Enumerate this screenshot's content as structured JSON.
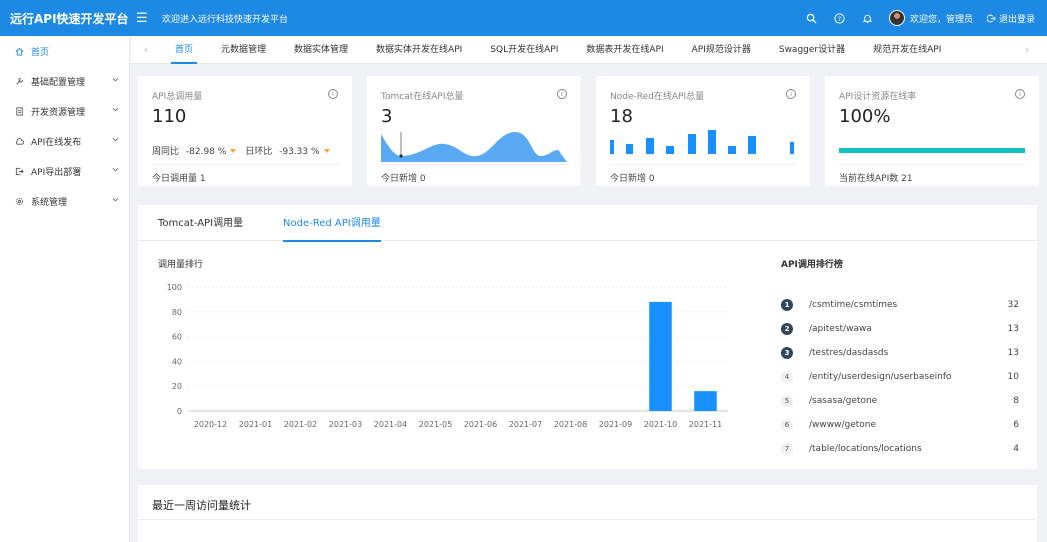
{
  "header": {
    "title": "远行API快速开发平台",
    "welcome": "欢迎进入远行科技快速开发平台",
    "user_greeting": "欢迎您，管理员",
    "logout_label": "退出登录",
    "icons": [
      "search-icon",
      "help-icon",
      "bell-icon"
    ]
  },
  "sidebar": {
    "items": [
      {
        "label": "首页",
        "icon": "home-icon",
        "active": true
      },
      {
        "label": "基础配置管理",
        "icon": "wrench-icon"
      },
      {
        "label": "开发资源管理",
        "icon": "document-icon"
      },
      {
        "label": "API在线发布",
        "icon": "cloud-icon"
      },
      {
        "label": "API导出部署",
        "icon": "export-icon"
      },
      {
        "label": "系统管理",
        "icon": "gear-icon"
      }
    ]
  },
  "tabs": {
    "items": [
      "首页",
      "元数据管理",
      "数据实体管理",
      "数据实体开发在线API",
      "SQL开发在线API",
      "数据表开发在线API",
      "API规范设计器",
      "Swagger设计器",
      "规范开发在线API"
    ],
    "active": 0
  },
  "cards": [
    {
      "title": "API总调用量",
      "value": "110",
      "compare_week_label": "周同比",
      "compare_week_value": "-82.98 %",
      "compare_day_label": "日环比",
      "compare_day_value": "-93.33 %",
      "footer": "今日调用量 1"
    },
    {
      "title": "Tomcat在线API总量",
      "value": "3",
      "footer": "今日新增 0"
    },
    {
      "title": "Node-Red在线API总量",
      "value": "18",
      "footer": "今日新增 0"
    },
    {
      "title": "API设计资源在线率",
      "value": "100%",
      "progress": 1.0,
      "footer": "当前在线API数 21"
    }
  ],
  "panel": {
    "tabs": [
      "Tomcat-API调用量",
      "Node-Red API调用量"
    ],
    "active_tab": 1,
    "chart_title": "调用量排行",
    "ranking_title": "API调用排行榜",
    "ranking": [
      {
        "rank": "1",
        "path": "/csmtime/csmtimes",
        "count": "32"
      },
      {
        "rank": "2",
        "path": "/apitest/wawa",
        "count": "13"
      },
      {
        "rank": "3",
        "path": "/testres/dasdasds",
        "count": "13"
      },
      {
        "rank": "4",
        "path": "/entity/userdesign/userbaseinfo",
        "count": "10"
      },
      {
        "rank": "5",
        "path": "/sasasa/getone",
        "count": "8"
      },
      {
        "rank": "6",
        "path": "/wwww/getone",
        "count": "6"
      },
      {
        "rank": "7",
        "path": "/table/locations/locations",
        "count": "4"
      }
    ]
  },
  "bottom": {
    "title": "最近一周访问量统计"
  },
  "colors": {
    "primary": "#1e88e5",
    "bar": "#1890ff",
    "progress": "#13c2c2",
    "area": "#5aa9f5"
  },
  "chart_data": {
    "type": "bar",
    "title": "调用量排行",
    "categories": [
      "2020-12",
      "2021-01",
      "2021-02",
      "2021-03",
      "2021-04",
      "2021-05",
      "2021-06",
      "2021-07",
      "2021-08",
      "2021-09",
      "2021-10",
      "2021-11"
    ],
    "values": [
      0,
      0,
      0,
      0,
      0,
      0,
      0,
      0,
      0,
      0,
      88,
      16
    ],
    "ylim": [
      0,
      100
    ],
    "yticks": [
      0,
      20,
      40,
      60,
      80,
      100
    ],
    "grid": true
  }
}
